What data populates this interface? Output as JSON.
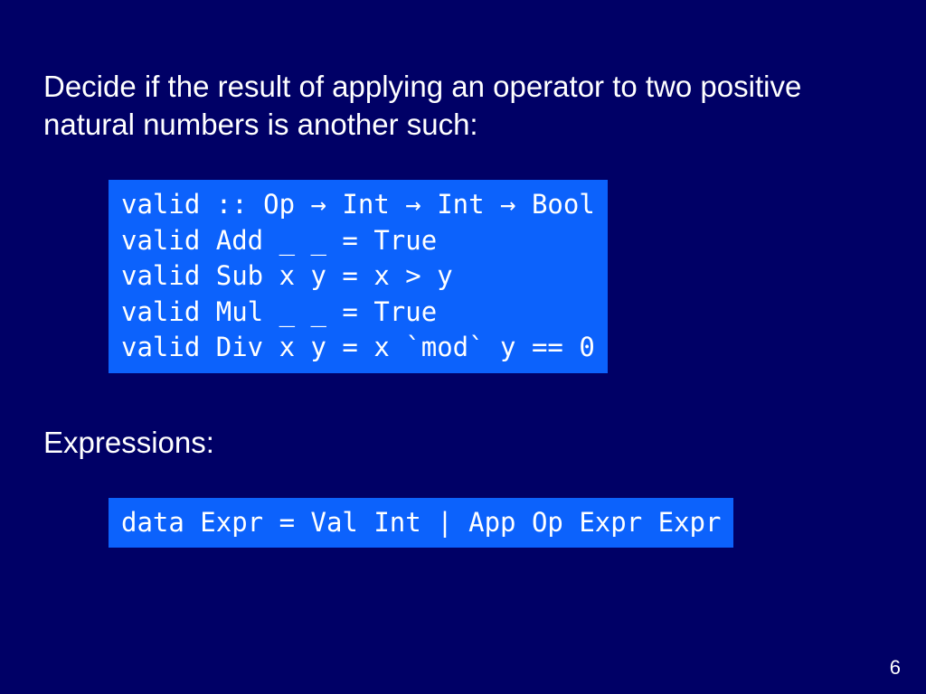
{
  "slide": {
    "intro_text": "Decide if the result of applying an operator to two positive natural numbers is another such:",
    "code1": "valid :: Op → Int → Int → Bool\nvalid Add _ _ = True\nvalid Sub x y = x > y\nvalid Mul _ _ = True\nvalid Div x y = x `mod` y == 0",
    "section_label": "Expressions:",
    "code2": "data Expr = Val Int | App Op Expr Expr",
    "page_number": "6"
  }
}
